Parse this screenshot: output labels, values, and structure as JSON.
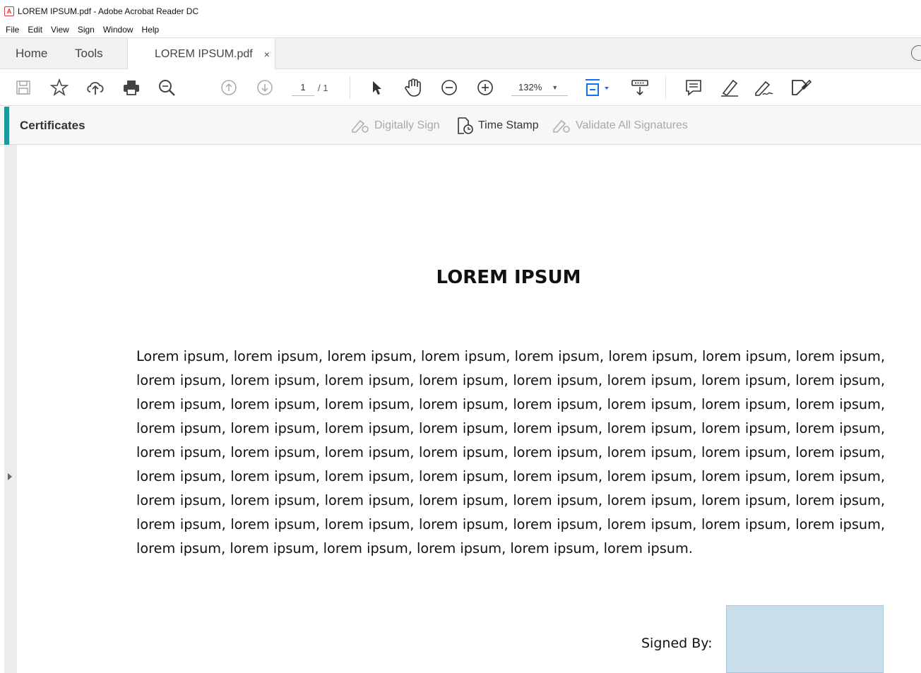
{
  "window": {
    "title": "LOREM IPSUM.pdf - Adobe Acrobat Reader DC"
  },
  "menu": [
    "File",
    "Edit",
    "View",
    "Sign",
    "Window",
    "Help"
  ],
  "tabs": {
    "home": "Home",
    "tools": "Tools",
    "document": "LOREM IPSUM.pdf",
    "close": "×"
  },
  "toolbar": {
    "icons": [
      "save-icon",
      "bookmark-star-icon",
      "upload-cloud-icon",
      "print-icon",
      "zoom-search-icon",
      "page-up-icon",
      "page-down-icon",
      "select-arrow-icon",
      "hand-icon",
      "zoom-out-icon",
      "zoom-in-icon",
      "fit-page-icon",
      "scroll-mode-icon",
      "comment-icon",
      "highlight-icon",
      "sign-icon",
      "more-tools-icon"
    ],
    "page_current": "1",
    "page_total": "/ 1",
    "zoom": "132%"
  },
  "certificates": {
    "label": "Certificates",
    "digitally_sign": "Digitally Sign",
    "time_stamp": "Time Stamp",
    "validate": "Validate All Signatures"
  },
  "document": {
    "heading": "LOREM IPSUM",
    "body": "Lorem ipsum, lorem ipsum, lorem ipsum, lorem ipsum, lorem ipsum, lorem ipsum, lorem ipsum, lorem ipsum, lorem ipsum, lorem ipsum, lorem ipsum, lorem ipsum, lorem ipsum, lorem ipsum, lorem ipsum, lorem ipsum, lorem ipsum, lorem ipsum, lorem ipsum, lorem ipsum, lorem ipsum, lorem ipsum, lorem ipsum, lorem ipsum, lorem ipsum, lorem ipsum, lorem ipsum, lorem ipsum, lorem ipsum, lorem ipsum, lorem ipsum, lorem ipsum, lorem ipsum, lorem ipsum, lorem ipsum, lorem ipsum, lorem ipsum, lorem ipsum, lorem ipsum, lorem ipsum, lorem ipsum, lorem ipsum, lorem ipsum, lorem ipsum, lorem ipsum, lorem ipsum, lorem ipsum, lorem ipsum, lorem ipsum, lorem ipsum, lorem ipsum, lorem ipsum, lorem ipsum, lorem ipsum, lorem ipsum, lorem ipsum, lorem ipsum, lorem ipsum, lorem ipsum, lorem ipsum, lorem ipsum, lorem ipsum, lorem ipsum, lorem ipsum, lorem ipsum, lorem ipsum, lorem ipsum, lorem ipsum, lorem ipsum, lorem ipsum.",
    "signed_by": "Signed By:"
  },
  "colors": {
    "accent": "#1a9a9a",
    "signature_box": "#c9deeb",
    "active_blue": "#1473e6"
  }
}
